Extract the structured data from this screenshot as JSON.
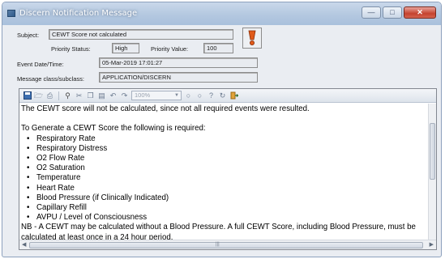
{
  "window": {
    "title": "Discern Notification Message"
  },
  "header": {
    "subject_label": "Subject:",
    "subject_value": "CEWT Score not calculated",
    "priority_status_label": "Priority Status:",
    "priority_status_value": "High",
    "priority_value_label": "Priority Value:",
    "priority_value_value": "100",
    "priority_icon": "exclamation-icon",
    "event_datetime_label": "Event Date/Time:",
    "event_datetime_value": "05-Mar-2019 17:01:27",
    "message_class_label": "Message class/subclass:",
    "message_class_value": "APPLICATION/DISCERN"
  },
  "toolbar": {
    "zoom_value": "100%"
  },
  "message": {
    "line1": "The CEWT score will not be calculated, since not all required events were resulted.",
    "line2": "To Generate a CEWT Score the following is required:",
    "items": [
      "Respiratory Rate",
      "Respiratory Distress",
      "O2 Flow Rate",
      "O2 Saturation",
      "Temperature",
      "Heart Rate",
      "Blood Pressure (if Clinically Indicated)",
      "Capillary Refill",
      "AVPU / Level of Consciousness"
    ],
    "note": "NB - A CEWT may be calculated without a Blood Pressure. A full CEWT Score, including Blood Pressure, must be calculated at least once in a 24 hour period."
  },
  "colors": {
    "title_bar": "#b4c8e0",
    "close_button": "#c5432f",
    "priority_icon": "#e05a1a"
  }
}
